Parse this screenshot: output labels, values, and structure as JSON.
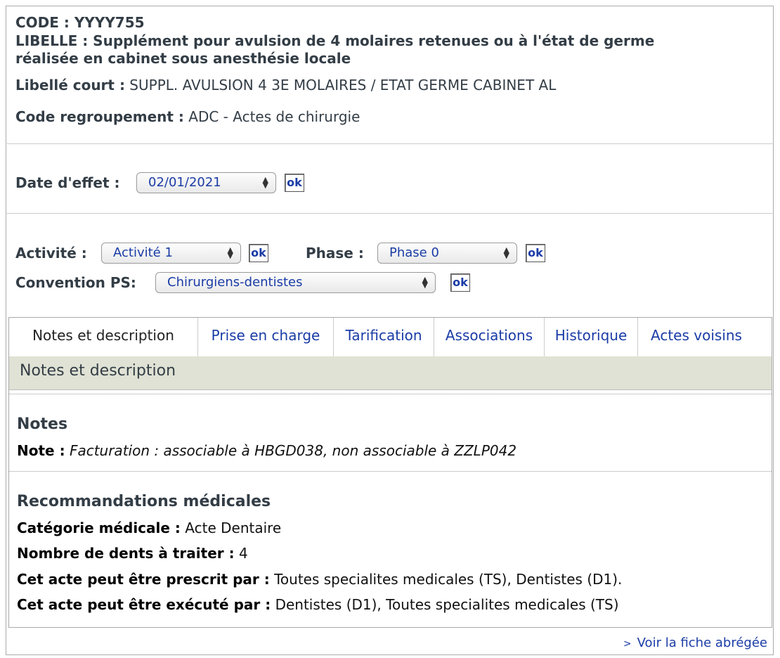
{
  "header": {
    "code_label": "CODE :",
    "code_value": "YYYY755",
    "libelle_label": "LIBELLE :",
    "libelle_value": "Supplément pour avulsion de 4 molaires retenues ou à l'état de germe",
    "libelle_value_2": "réalisée en cabinet sous anesthésie locale",
    "libelle_court_label": "Libellé court :",
    "libelle_court_value": "SUPPL. AVULSION 4 3E MOLAIRES / ETAT GERME CABINET AL",
    "code_regroupement_label": "Code regroupement :",
    "code_regroupement_value": "ADC - Actes de chirurgie"
  },
  "date_effet": {
    "label": "Date d'effet :",
    "value": "02/01/2021",
    "ok": "ok"
  },
  "filters": {
    "activite_label": "Activité :",
    "activite_value": "Activité 1",
    "phase_label": "Phase :",
    "phase_value": "Phase 0",
    "convention_label": "Convention PS:",
    "convention_value": "Chirurgiens-dentistes",
    "ok": "ok"
  },
  "tabs": [
    {
      "label": "Notes et description"
    },
    {
      "label": "Prise en charge"
    },
    {
      "label": "Tarification"
    },
    {
      "label": "Associations"
    },
    {
      "label": "Historique"
    },
    {
      "label": "Actes voisins"
    }
  ],
  "section_title": "Notes et description",
  "notes": {
    "heading": "Notes",
    "note_label": "Note :",
    "note_value": "Facturation : associable à HBGD038, non associable à ZZLP042"
  },
  "recommandations": {
    "heading": "Recommandations médicales",
    "categorie_label": "Catégorie médicale :",
    "categorie_value": "Acte Dentaire",
    "dents_label": "Nombre de dents à traiter :",
    "dents_value": "4",
    "prescrit_label": "Cet acte peut être prescrit par :",
    "prescrit_value": "Toutes specialites medicales (TS), Dentistes (D1).",
    "execute_label": "Cet acte peut être exécuté par :",
    "execute_value": "Dentistes (D1), Toutes specialites medicales (TS)"
  },
  "footer": {
    "link": "Voir la fiche abrégée"
  }
}
